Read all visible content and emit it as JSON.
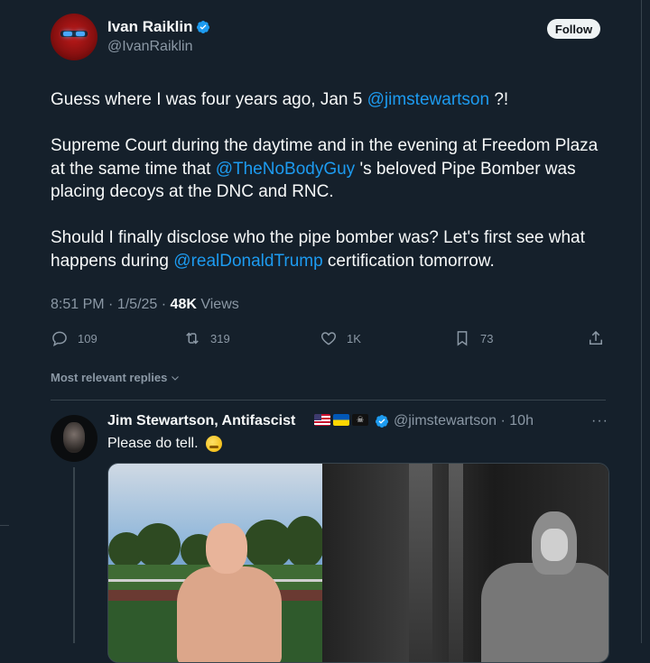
{
  "tweet": {
    "author_name": "Ivan Raiklin",
    "handle": "@IvanRaiklin",
    "follow_label": "Follow",
    "paragraphs": [
      [
        {
          "text": "Guess where I was four years ago, Jan 5 ",
          "mention": false
        },
        {
          "text": "@jimstewartson",
          "mention": true
        },
        {
          "text": " ?!",
          "mention": false
        }
      ],
      [
        {
          "text": "Supreme Court during the daytime and in the evening at Freedom Plaza at the same time that ",
          "mention": false
        },
        {
          "text": "@TheNoBodyGuy",
          "mention": true
        },
        {
          "text": " 's beloved Pipe Bomber was placing decoys at the DNC and RNC.",
          "mention": false
        }
      ],
      [
        {
          "text": "Should I finally disclose who the pipe bomber was?  Let's first see what happens during ",
          "mention": false
        },
        {
          "text": "@realDonaldTrump",
          "mention": true
        },
        {
          "text": " certification tomorrow.",
          "mention": false
        }
      ]
    ],
    "time": "8:51 PM",
    "separator": "·",
    "date": "1/5/25",
    "views_count": "48K",
    "views_label": "Views",
    "actions": {
      "replies": "109",
      "reposts": "319",
      "likes": "1K",
      "bookmarks": "73"
    }
  },
  "replies_filter": {
    "label": "Most relevant replies"
  },
  "reply": {
    "author_name": "Jim Stewartson, Antifascist",
    "handle": "@jimstewartson",
    "time": "10h",
    "separator": "·",
    "more_label": "···",
    "text": "Please do tell.",
    "emoji": "🫡"
  },
  "colors": {
    "background": "#15202b",
    "accent": "#1d9bf0",
    "text": "#f7f9f9",
    "muted": "#8b98a5",
    "border": "#38444d"
  },
  "icons": [
    "verified-badge-icon",
    "reply-icon",
    "repost-icon",
    "like-icon",
    "bookmark-icon",
    "share-icon",
    "chevron-down-icon"
  ]
}
